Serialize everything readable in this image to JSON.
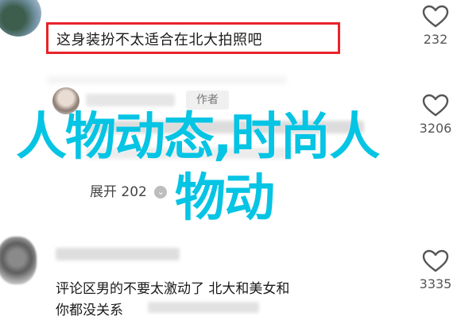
{
  "comments": [
    {
      "text": "这身装扮不太适合在北大拍照吧",
      "likes": "232"
    },
    {
      "author_tag": "作者",
      "expand_label": "展开 202",
      "expand_icon": "chevron-down-icon",
      "likes": "3206"
    },
    {
      "text_line1": "评论区男的不要太激动了 北大和美女和",
      "text_line2": "你都没关系",
      "likes": "3335"
    }
  ],
  "overlay": {
    "line1": "人物动态,时尚人",
    "line2": "物动"
  },
  "colors": {
    "highlight_border": "#e8232b",
    "overlay_text": "#06c4e4"
  },
  "icons": {
    "like": "heart-icon"
  }
}
